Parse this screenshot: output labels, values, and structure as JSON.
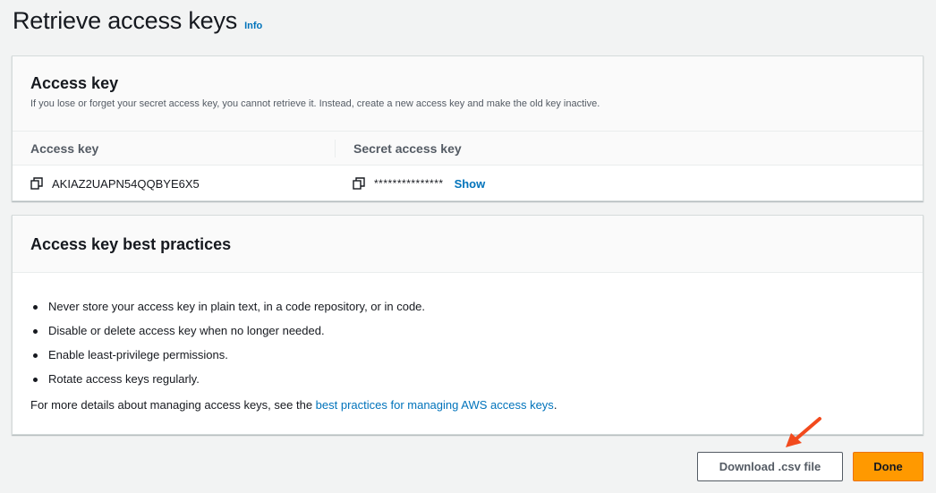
{
  "header": {
    "title": "Retrieve access keys",
    "info_label": "Info"
  },
  "access_key_panel": {
    "heading": "Access key",
    "description": "If you lose or forget your secret access key, you cannot retrieve it. Instead, create a new access key and make the old key inactive.",
    "columns": [
      "Access key",
      "Secret access key"
    ],
    "access_key_value": "AKIAZ2UAPN54QQBYE6X5",
    "secret_masked": "***************",
    "show_label": "Show",
    "icon": "copy-icon"
  },
  "best_practices_panel": {
    "heading": "Access key best practices",
    "items": [
      "Never store your access key in plain text, in a code repository, or in code.",
      "Disable or delete access key when no longer needed.",
      "Enable least-privilege permissions.",
      "Rotate access keys regularly."
    ],
    "footer_prefix": "For more details about managing access keys, see the ",
    "footer_link": "best practices for managing AWS access keys",
    "footer_suffix": "."
  },
  "actions": {
    "download_label": "Download .csv file",
    "done_label": "Done"
  },
  "colors": {
    "link": "#0073bb",
    "primary_button": "#ff9900",
    "annotation_arrow": "#f24a1d"
  }
}
